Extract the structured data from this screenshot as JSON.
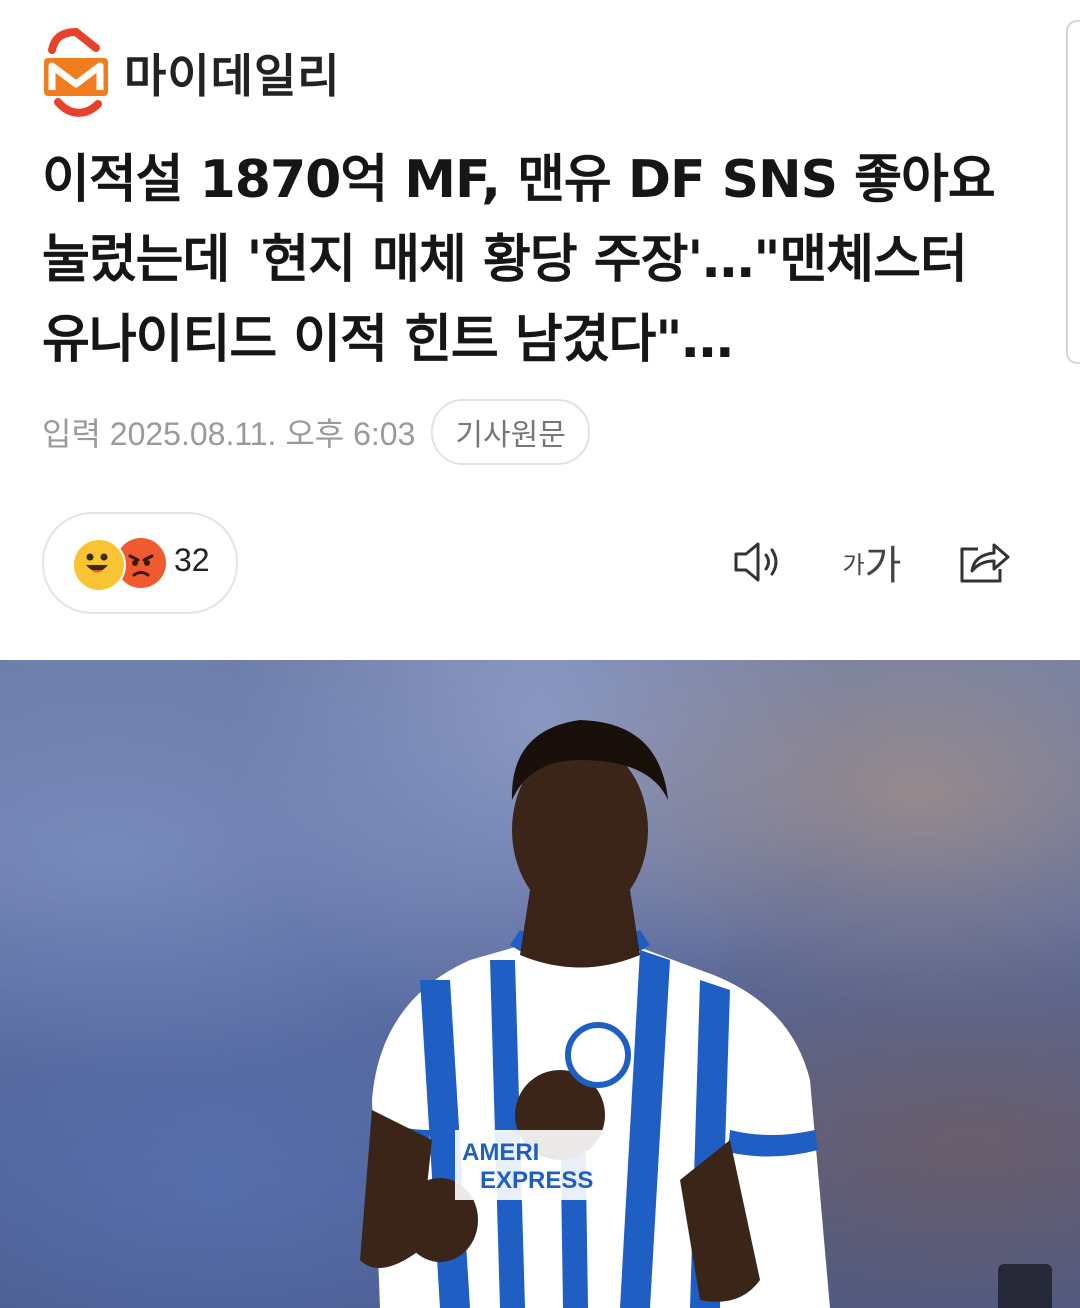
{
  "header": {
    "logo_text": "마이데일리"
  },
  "article": {
    "headline": "이적설 1870억 MF, 맨유 DF SNS 좋아요 눌렀는데 '현지 매체 황당 주장'…\"맨체스터 유나이티드 이적 힌트 남겼다\"…",
    "published": "입력 2025.08.11. 오후 6:03",
    "source_button": "기사원문"
  },
  "reactions": {
    "count": "32"
  },
  "toolbar": {
    "font_small": "가",
    "font_large": "가"
  },
  "colors": {
    "logo_orange": "#f07c1e",
    "logo_red": "#e8412b",
    "meta_gray": "#9a9a9a"
  }
}
